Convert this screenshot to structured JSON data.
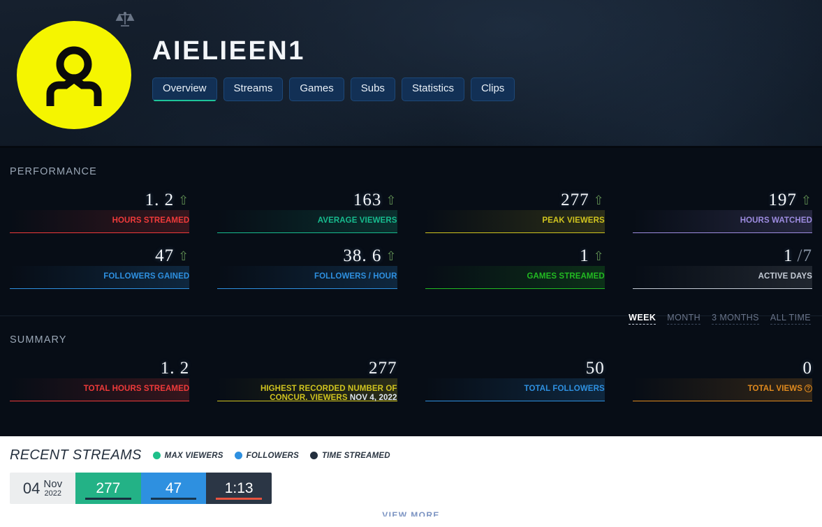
{
  "header": {
    "channel_name": "AIELIEEN1",
    "avatar_bg": "#f5f500",
    "avatar_icon": "user-avatar-icon",
    "badge_icon": "scales-icon",
    "tabs": [
      {
        "label": "Overview",
        "active": true
      },
      {
        "label": "Streams",
        "active": false
      },
      {
        "label": "Games",
        "active": false
      },
      {
        "label": "Subs",
        "active": false
      },
      {
        "label": "Statistics",
        "active": false
      },
      {
        "label": "Clips",
        "active": false
      }
    ]
  },
  "performance": {
    "title": "PERFORMANCE",
    "ranges": [
      {
        "label": "WEEK",
        "active": true
      },
      {
        "label": "MONTH",
        "active": false
      },
      {
        "label": "3 MONTHS",
        "active": false
      },
      {
        "label": "ALL TIME",
        "active": false
      }
    ],
    "stats": [
      {
        "value": "1. 2",
        "label": "HOURS STREAMED",
        "color": "#ef3a3a",
        "trend": "up"
      },
      {
        "value": "163",
        "label": "AVERAGE VIEWERS",
        "color": "#17bb8e",
        "trend": "up"
      },
      {
        "value": "277",
        "label": "PEAK VIEWERS",
        "color": "#d0c41f",
        "trend": "up"
      },
      {
        "value": "197",
        "label": "HOURS WATCHED",
        "color": "#9d8ce0",
        "trend": "up"
      },
      {
        "value": "47",
        "label": "FOLLOWERS GAINED",
        "color": "#2e90e0",
        "trend": "up"
      },
      {
        "value": "38. 6",
        "label": "FOLLOWERS / HOUR",
        "color": "#2e90e0",
        "trend": "up"
      },
      {
        "value": "1",
        "label": "GAMES STREAMED",
        "color": "#22bb22",
        "trend": "up"
      },
      {
        "value": "1",
        "denominator": "/7",
        "label": "ACTIVE DAYS",
        "color": "#d8dde4",
        "trend": "none"
      }
    ]
  },
  "summary": {
    "title": "SUMMARY",
    "stats": [
      {
        "value": "1. 2",
        "label": "TOTAL HOURS STREAMED",
        "color": "#ef3a3a"
      },
      {
        "value": "277",
        "label_line1": "HIGHEST RECORDED NUMBER OF",
        "label_line2": "CONCUR. VIEWERS",
        "label_date": "NOV 4, 2022",
        "color": "#d0c41f"
      },
      {
        "value": "50",
        "label": "TOTAL FOLLOWERS",
        "color": "#2e90e0"
      },
      {
        "value": "0",
        "label": "TOTAL VIEWS",
        "help": "?",
        "color": "#e08a1e"
      }
    ]
  },
  "recent_streams": {
    "title": "RECENT STREAMS",
    "legend": [
      {
        "label": "MAX VIEWERS",
        "color": "#1fc08a"
      },
      {
        "label": "FOLLOWERS",
        "color": "#2e90e0"
      },
      {
        "label": "TIME STREAMED",
        "color": "#232f3e"
      }
    ],
    "rows": [
      {
        "day": "04",
        "month": "Nov",
        "year": "2022",
        "max_viewers": "277",
        "followers": "47",
        "time_streamed": "1:13",
        "max_viewers_bg": "#23b286",
        "followers_bg": "#2e90e0",
        "time_bg": "#2b3645",
        "max_viewers_bar": "#17303f",
        "followers_bar": "#16354f",
        "time_bar": "#e8533f"
      }
    ],
    "view_more": "VIEW MORE"
  }
}
